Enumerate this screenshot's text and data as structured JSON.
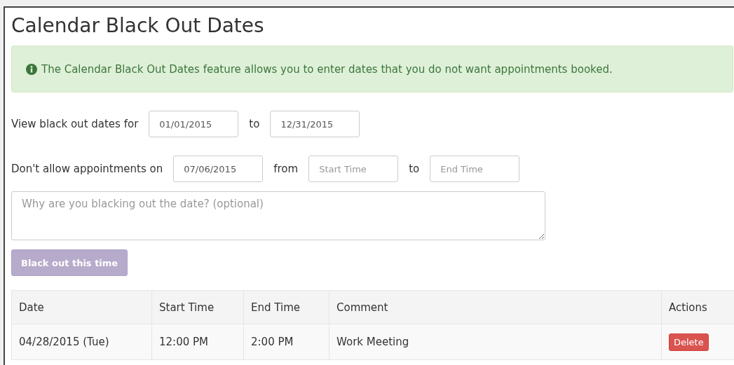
{
  "title": "Calendar Black Out Dates",
  "alert": {
    "text": "The Calendar Black Out Dates feature allows you to enter dates that you do not want appointments booked."
  },
  "view_range": {
    "label": "View black out dates for",
    "from": "01/01/2015",
    "separator": "to",
    "to": "12/31/2015"
  },
  "blackout": {
    "label": "Don't allow appointments on",
    "date": "07/06/2015",
    "from_label": "from",
    "start_placeholder": "Start Time",
    "to_label": "to",
    "end_placeholder": "End Time"
  },
  "reason": {
    "placeholder": "Why are you blacking out the date? (optional)"
  },
  "submit": {
    "label": "Black out this time",
    "disabled": true
  },
  "table": {
    "columns": [
      "Date",
      "Start Time",
      "End Time",
      "Comment",
      "Actions"
    ],
    "rows": [
      {
        "date": "04/28/2015 (Tue)",
        "start": "12:00 PM",
        "end": "2:00 PM",
        "comment": "Work Meeting",
        "action": "Delete"
      }
    ]
  }
}
